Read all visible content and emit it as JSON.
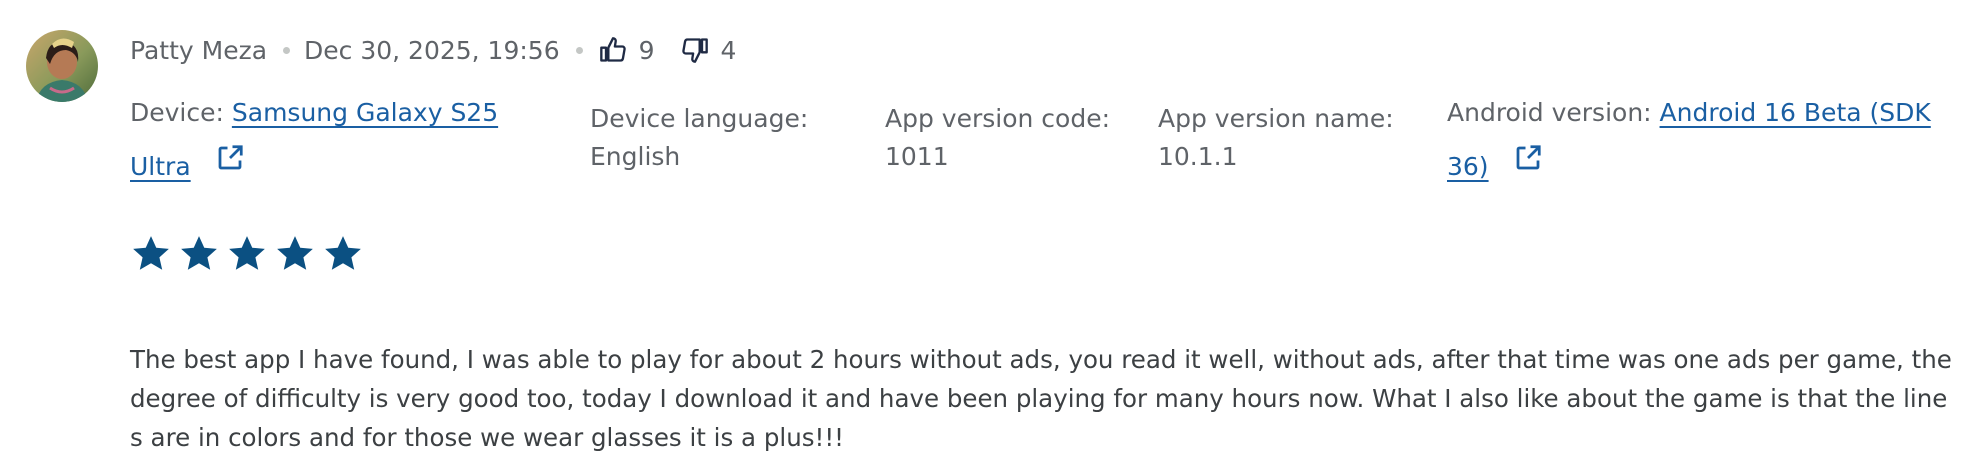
{
  "review": {
    "author": "Patty Meza",
    "date": "Dec 30, 2025, 19:56",
    "upvotes": "9",
    "downvotes": "4",
    "device_label": "Device: ",
    "device_value_line1": "Samsung Galaxy S25",
    "device_value_line2": "Ultra",
    "language_label": "Device language:",
    "language_value": "English",
    "version_code_label": "App version code:",
    "version_code_value": "1011",
    "version_name_label": "App version name:",
    "version_name_value": "10.1.1",
    "android_label": "Android version: ",
    "android_value_line1": "Android 16 Beta (SDK",
    "android_value_line2": "36)",
    "rating": 5,
    "rating_max": 5,
    "text": "The best app I have found, I was able to play for about 2 hours without ads, you read it well, without ads, after that time was one ads per game, the degree of difficulty is very good too, today I download it and have been playing for many hours now. What I also like about the game is that the lines are in colors and for those we wear glasses it is a plus!!!"
  },
  "colors": {
    "link": "#1a5fa3",
    "star": "#0b5082",
    "meta_text": "#5f6368",
    "body_text": "#3c4043"
  },
  "icons": {
    "upvote": "thumb-up-icon",
    "downvote": "thumb-down-icon",
    "external": "open-in-new-icon",
    "star": "star-icon"
  }
}
